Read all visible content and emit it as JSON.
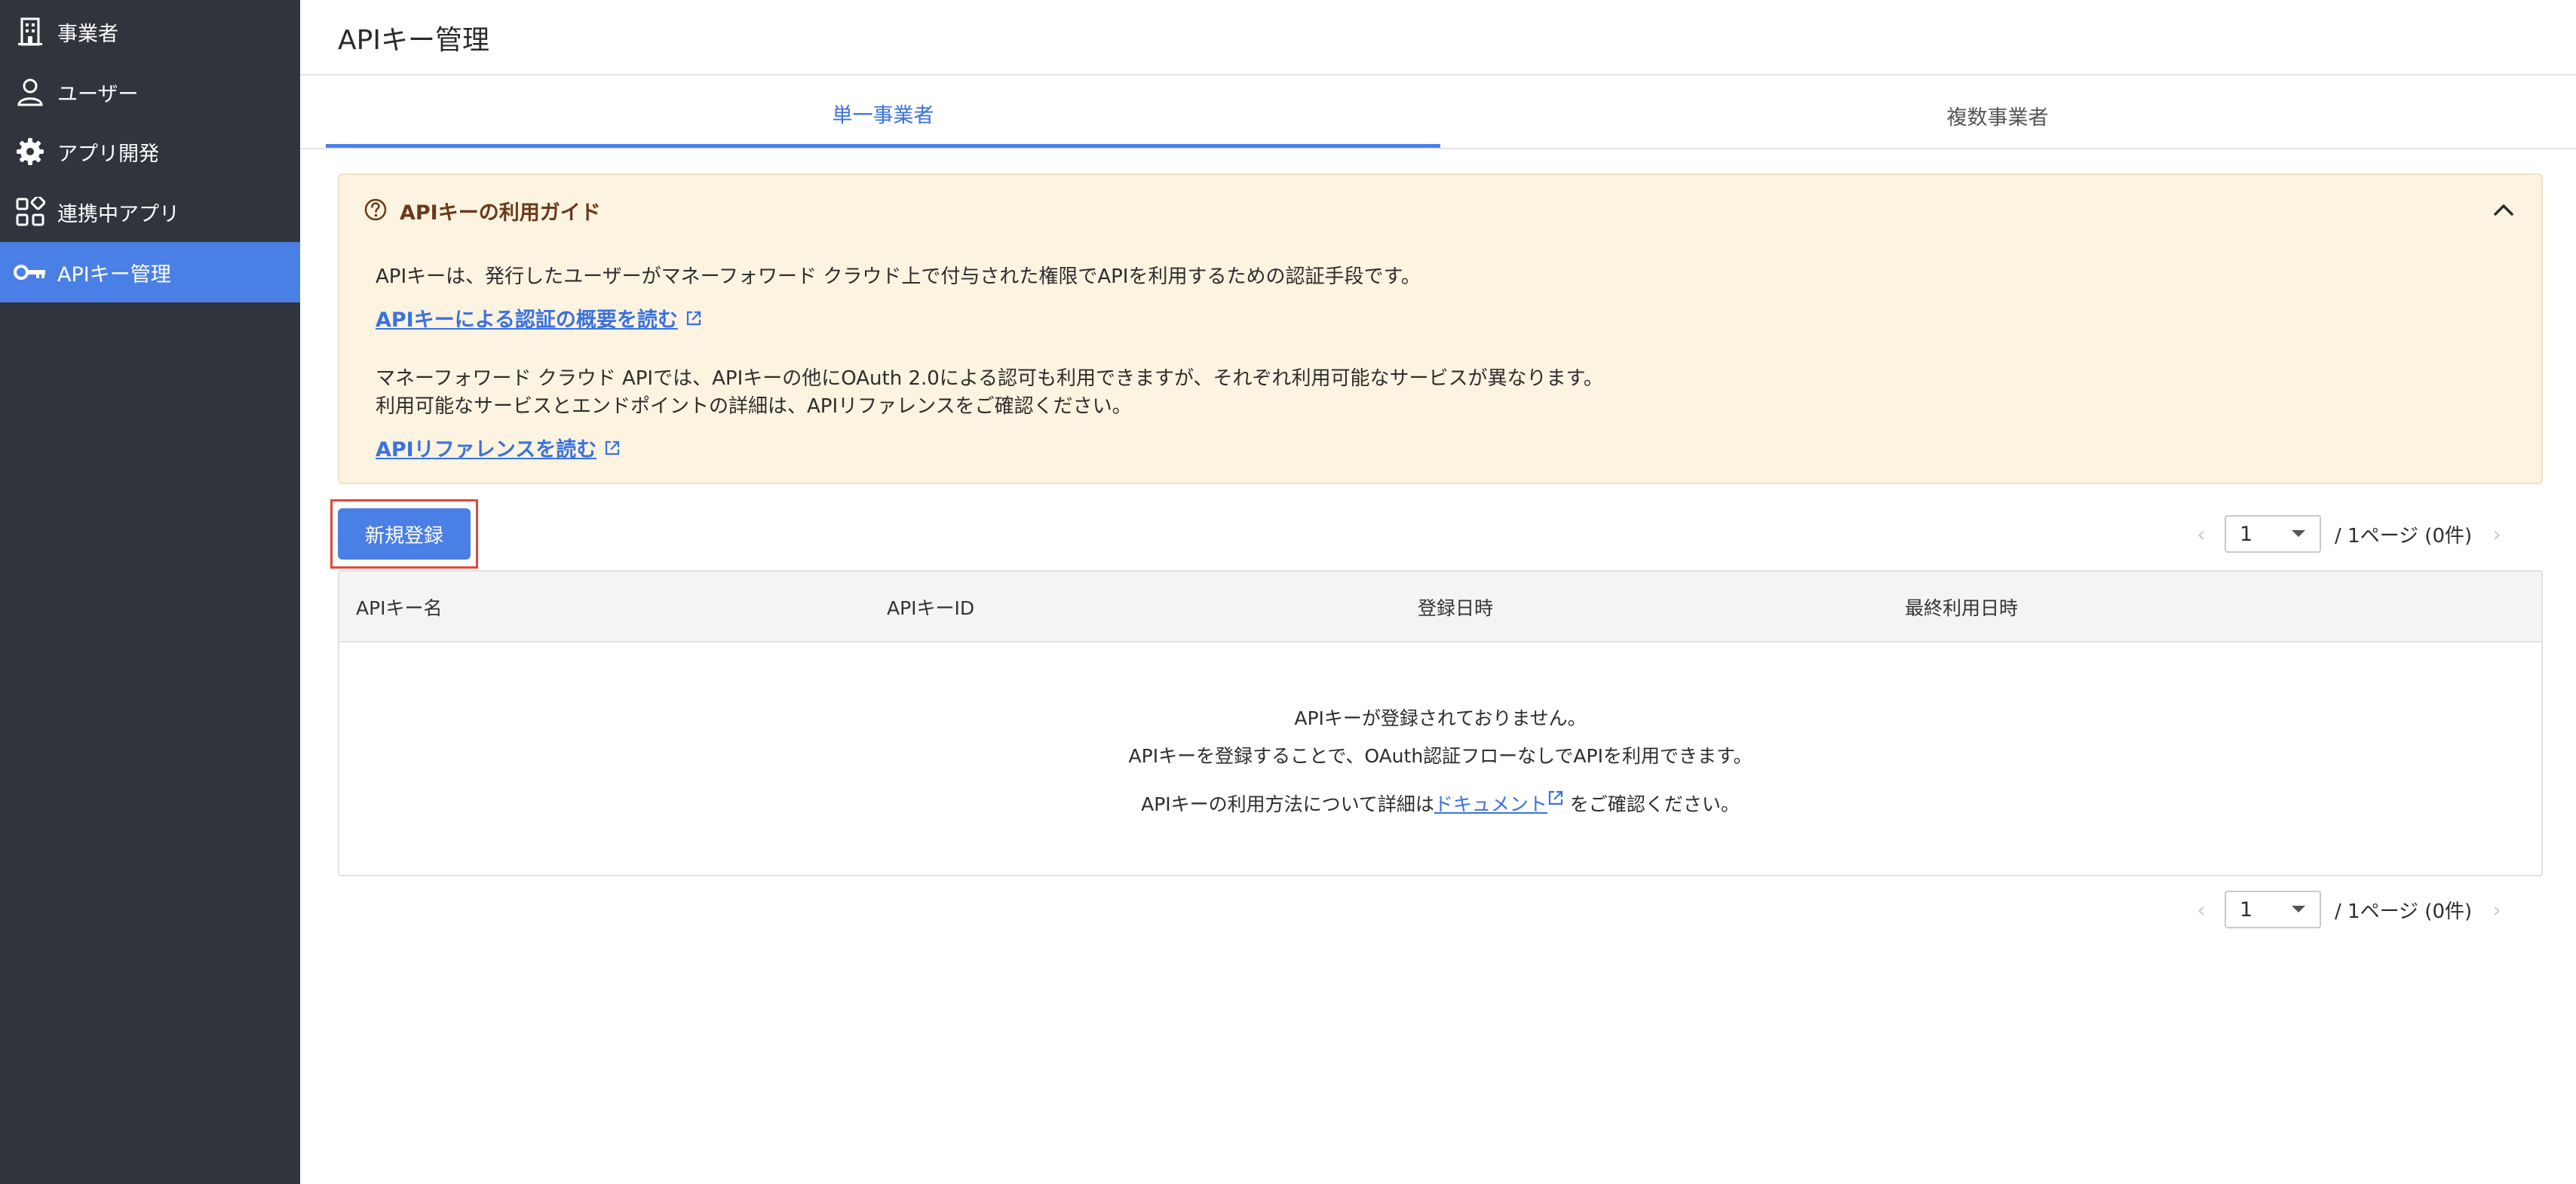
{
  "sidebar": {
    "items": [
      {
        "label": "事業者",
        "icon": "building-icon",
        "active": false
      },
      {
        "label": "ユーザー",
        "icon": "user-icon",
        "active": false
      },
      {
        "label": "アプリ開発",
        "icon": "gear-icon",
        "active": false
      },
      {
        "label": "連携中アプリ",
        "icon": "apps-grid-icon",
        "active": false
      },
      {
        "label": "APIキー管理",
        "icon": "key-icon",
        "active": true
      }
    ]
  },
  "page": {
    "title": "APIキー管理",
    "tabs": [
      {
        "label": "単一事業者",
        "active": true
      },
      {
        "label": "複数事業者",
        "active": false
      }
    ]
  },
  "guide": {
    "title": "APIキーの利用ガイド",
    "line1": "APIキーは、発行したユーザーがマネーフォワード クラウド上で付与された権限でAPIを利用するための認証手段です。",
    "link1": "APIキーによる認証の概要を読む",
    "line2": "マネーフォワード クラウド APIでは、APIキーの他にOAuth 2.0による認可も利用できますが、それぞれ利用可能なサービスが異なります。",
    "line3": "利用可能なサービスとエンドポイントの詳細は、APIリファレンスをご確認ください。",
    "link2": "APIリファレンスを読む"
  },
  "toolbar": {
    "new_label": "新規登録"
  },
  "pager": {
    "page": "1",
    "info": "/ 1ページ (0件)"
  },
  "table": {
    "columns": [
      "APIキー名",
      "APIキーID",
      "登録日時",
      "最終利用日時"
    ],
    "empty": {
      "line1": "APIキーが登録されておりません。",
      "line2": "APIキーを登録することで、OAuth認証フローなしでAPIを利用できます。",
      "line3_pre": "APIキーの利用方法について詳細は",
      "line3_link": "ドキュメント",
      "line3_post": " をご確認ください。"
    }
  },
  "colors": {
    "sidebar_bg": "#30343c",
    "accent": "#4a7fe6",
    "guide_bg": "#fdf3e1",
    "highlight": "#e0483b"
  }
}
